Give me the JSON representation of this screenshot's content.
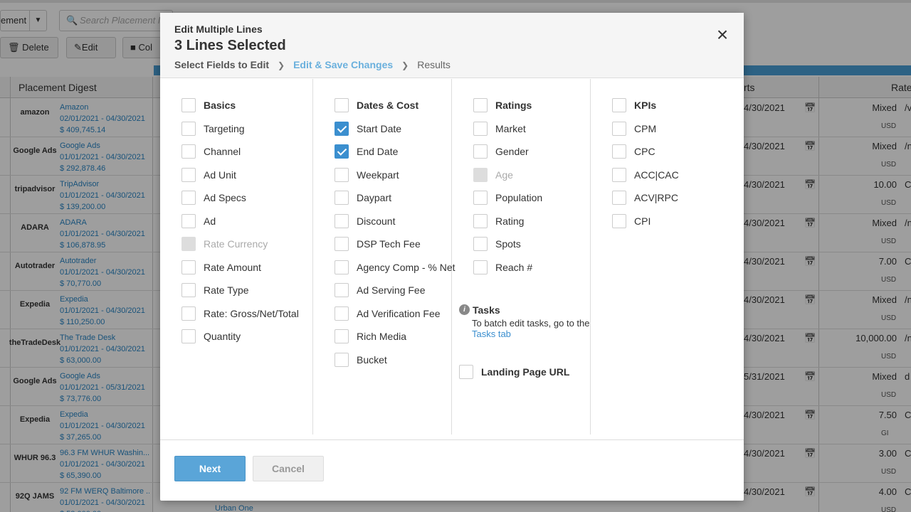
{
  "background": {
    "select_label": "ement",
    "search_placeholder": "Search Placement N",
    "delete_label": "Delete",
    "edit_label": "Edit",
    "columns_label": "Col",
    "col_placement_digest": "Placement Digest",
    "col_starts": "rts",
    "col_rate": "Rate",
    "rows": [
      {
        "logo": "amazon",
        "name": "Amazon",
        "dates": "02/01/2021 - 04/30/2021",
        "amount": "$ 409,745.14",
        "end": "4/30/2021",
        "rate": "Mixed",
        "cur": "USD",
        "mid": "/v"
      },
      {
        "logo": "Google Ads",
        "name": "Google Ads",
        "dates": "01/01/2021 - 04/30/2021",
        "amount": "$ 292,878.46",
        "end": "4/30/2021",
        "rate": "Mixed",
        "cur": "USD",
        "mid": "/n"
      },
      {
        "logo": "tripadvisor",
        "name": "TripAdvisor",
        "dates": "01/01/2021 - 04/30/2021",
        "amount": "$ 139,200.00",
        "end": "4/30/2021",
        "rate": "10.00",
        "cur": "USD",
        "mid": "C"
      },
      {
        "logo": "ADARA",
        "name": "ADARA",
        "dates": "01/01/2021 - 04/30/2021",
        "amount": "$ 106,878.95",
        "end": "4/30/2021",
        "rate": "Mixed",
        "cur": "USD",
        "mid": "/n"
      },
      {
        "logo": "Autotrader",
        "name": "Autotrader",
        "dates": "01/01/2021 - 04/30/2021",
        "amount": "$ 70,770.00",
        "end": "4/30/2021",
        "rate": "7.00",
        "cur": "USD",
        "mid": "C"
      },
      {
        "logo": "Expedia",
        "name": "Expedia",
        "dates": "01/01/2021 - 04/30/2021",
        "amount": "$ 110,250.00",
        "end": "4/30/2021",
        "rate": "Mixed",
        "cur": "USD",
        "mid": "/n"
      },
      {
        "logo": "theTradeDesk",
        "name": "The Trade Desk",
        "dates": "01/01/2021 - 04/30/2021",
        "amount": "$ 63,000.00",
        "end": "4/30/2021",
        "rate": "10,000.00",
        "cur": "USD",
        "mid": "/n"
      },
      {
        "logo": "Google Ads",
        "name": "Google Ads",
        "dates": "01/01/2021 - 05/31/2021",
        "amount": "$ 73,776.00",
        "end": "5/31/2021",
        "rate": "Mixed",
        "cur": "USD",
        "mid": "d"
      },
      {
        "logo": "Expedia",
        "name": "Expedia",
        "dates": "01/01/2021 - 04/30/2021",
        "amount": "$ 37,265.00",
        "end": "4/30/2021",
        "rate": "7.50",
        "cur": "GI",
        "mid": "C"
      },
      {
        "logo": "WHUR 96.3",
        "name": "96.3 FM WHUR Washin...",
        "dates": "01/01/2021 - 04/30/2021",
        "amount": "$ 65,390.00",
        "end": "4/30/2021",
        "rate": "3.00",
        "cur": "USD",
        "mid": "C"
      },
      {
        "logo": "92Q JAMS",
        "name": "92 FM WERQ Baltimore ...",
        "dates": "01/01/2021 - 04/30/2021",
        "amount": "$ 53,000.00",
        "end": "4/30/2021",
        "rate": "4.00",
        "cur": "USD",
        "mid": "C"
      }
    ],
    "footer_link": "Urban One"
  },
  "modal": {
    "title": "Edit Multiple Lines",
    "subtitle": "3 Lines Selected",
    "breadcrumbs": [
      "Select Fields to Edit",
      "Edit & Save Changes",
      "Results"
    ],
    "columns": [
      {
        "items": [
          {
            "label": "Basics",
            "head": true,
            "state": "unchecked"
          },
          {
            "label": "Targeting",
            "state": "unchecked"
          },
          {
            "label": "Channel",
            "state": "unchecked"
          },
          {
            "label": "Ad Unit",
            "state": "unchecked"
          },
          {
            "label": "Ad Specs",
            "state": "unchecked"
          },
          {
            "label": "Ad",
            "state": "unchecked"
          },
          {
            "label": "Rate Currency",
            "state": "disabled"
          },
          {
            "label": "Rate Amount",
            "state": "unchecked"
          },
          {
            "label": "Rate Type",
            "state": "unchecked"
          },
          {
            "label": "Rate: Gross/Net/Total",
            "state": "unchecked"
          },
          {
            "label": "Quantity",
            "state": "unchecked"
          }
        ]
      },
      {
        "items": [
          {
            "label": "Dates & Cost",
            "head": true,
            "state": "unchecked"
          },
          {
            "label": "Start Date",
            "state": "checked"
          },
          {
            "label": "End Date",
            "state": "checked"
          },
          {
            "label": "Weekpart",
            "state": "unchecked"
          },
          {
            "label": "Daypart",
            "state": "unchecked"
          },
          {
            "label": "Discount",
            "state": "unchecked"
          },
          {
            "label": "DSP Tech Fee",
            "state": "unchecked"
          },
          {
            "label": "Agency Comp - % Net",
            "state": "unchecked"
          },
          {
            "label": "Ad Serving Fee",
            "state": "unchecked"
          },
          {
            "label": "Ad Verification Fee",
            "state": "unchecked"
          },
          {
            "label": "Rich Media",
            "state": "unchecked"
          },
          {
            "label": "Bucket",
            "state": "unchecked"
          }
        ]
      },
      {
        "items": [
          {
            "label": "Ratings",
            "head": true,
            "state": "unchecked"
          },
          {
            "label": "Market",
            "state": "unchecked"
          },
          {
            "label": "Gender",
            "state": "unchecked"
          },
          {
            "label": "Age",
            "state": "disabled"
          },
          {
            "label": "Population",
            "state": "unchecked"
          },
          {
            "label": "Rating",
            "state": "unchecked"
          },
          {
            "label": "Spots",
            "state": "unchecked"
          },
          {
            "label": "Reach #",
            "state": "unchecked"
          }
        ]
      },
      {
        "items": [
          {
            "label": "KPIs",
            "head": true,
            "state": "unchecked"
          },
          {
            "label": "CPM",
            "state": "unchecked"
          },
          {
            "label": "CPC",
            "state": "unchecked"
          },
          {
            "label": "ACC|CAC",
            "state": "unchecked"
          },
          {
            "label": "ACV|RPC",
            "state": "unchecked"
          },
          {
            "label": "CPI",
            "state": "unchecked"
          }
        ]
      }
    ],
    "tasks": {
      "title": "Tasks",
      "text_before": "To batch edit tasks, go to the",
      "link": "Tasks tab"
    },
    "landing_page": {
      "label": "Landing Page URL",
      "state": "unchecked"
    },
    "next_label": "Next",
    "cancel_label": "Cancel",
    "close_icon": "close-icon"
  }
}
